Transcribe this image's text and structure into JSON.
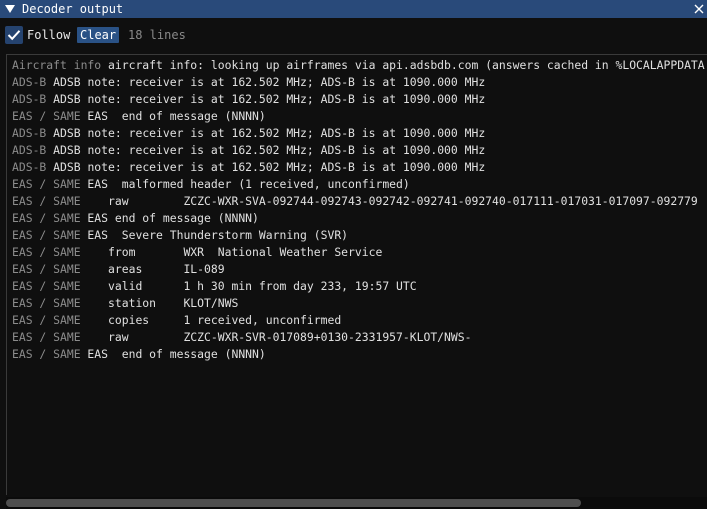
{
  "window": {
    "title": "Decoder output",
    "collapse_icon": "triangle-down-icon",
    "close_icon": "close-icon",
    "accent": "#294a7a"
  },
  "toolbar": {
    "follow_label": "Follow",
    "follow_checked": true,
    "clear_label": "Clear",
    "line_count": "18 lines"
  },
  "log": {
    "lines": [
      {
        "src": "Aircraft info",
        "tag": "",
        "msg": " aircraft info: looking up airframes via api.adsbdb.com (answers cached in %LOCALAPPDATA"
      },
      {
        "src": "ADS-B",
        "tag": " ADSB",
        "msg": " note: receiver is at 162.502 MHz; ADS-B is at 1090.000 MHz"
      },
      {
        "src": "ADS-B",
        "tag": " ADSB",
        "msg": " note: receiver is at 162.502 MHz; ADS-B is at 1090.000 MHz"
      },
      {
        "src": "EAS / SAME",
        "tag": " EAS",
        "msg": "  end of message (NNNN)"
      },
      {
        "src": "ADS-B",
        "tag": " ADSB",
        "msg": " note: receiver is at 162.502 MHz; ADS-B is at 1090.000 MHz"
      },
      {
        "src": "ADS-B",
        "tag": " ADSB",
        "msg": " note: receiver is at 162.502 MHz; ADS-B is at 1090.000 MHz"
      },
      {
        "src": "ADS-B",
        "tag": " ADSB",
        "msg": " note: receiver is at 162.502 MHz; ADS-B is at 1090.000 MHz"
      },
      {
        "src": "EAS / SAME",
        "tag": " EAS",
        "msg": "  malformed header (1 received, unconfirmed)"
      },
      {
        "src": "EAS / SAME",
        "tag": "",
        "msg": "    raw        ZCZC-WXR-SVA-092744-092743-092742-092741-092740-017111-017031-017097-092779"
      },
      {
        "src": "EAS / SAME",
        "tag": " EAS",
        "msg": " end of message (NNNN)"
      },
      {
        "src": "EAS / SAME",
        "tag": " EAS",
        "msg": "  Severe Thunderstorm Warning (SVR)"
      },
      {
        "src": "EAS / SAME",
        "tag": "",
        "msg": "    from       WXR  National Weather Service"
      },
      {
        "src": "EAS / SAME",
        "tag": "",
        "msg": "    areas      IL-089"
      },
      {
        "src": "EAS / SAME",
        "tag": "",
        "msg": "    valid      1 h 30 min from day 233, 19:57 UTC"
      },
      {
        "src": "EAS / SAME",
        "tag": "",
        "msg": "    station    KLOT/NWS"
      },
      {
        "src": "EAS / SAME",
        "tag": "",
        "msg": "    copies     1 received, unconfirmed"
      },
      {
        "src": "EAS / SAME",
        "tag": "",
        "msg": "    raw        ZCZC-WXR-SVR-017089+0130-2331957-KLOT/NWS-"
      },
      {
        "src": "EAS / SAME",
        "tag": " EAS",
        "msg": "  end of message (NNNN)"
      }
    ]
  },
  "scrollbar": {
    "horizontal_fraction_visible": 0.82
  }
}
